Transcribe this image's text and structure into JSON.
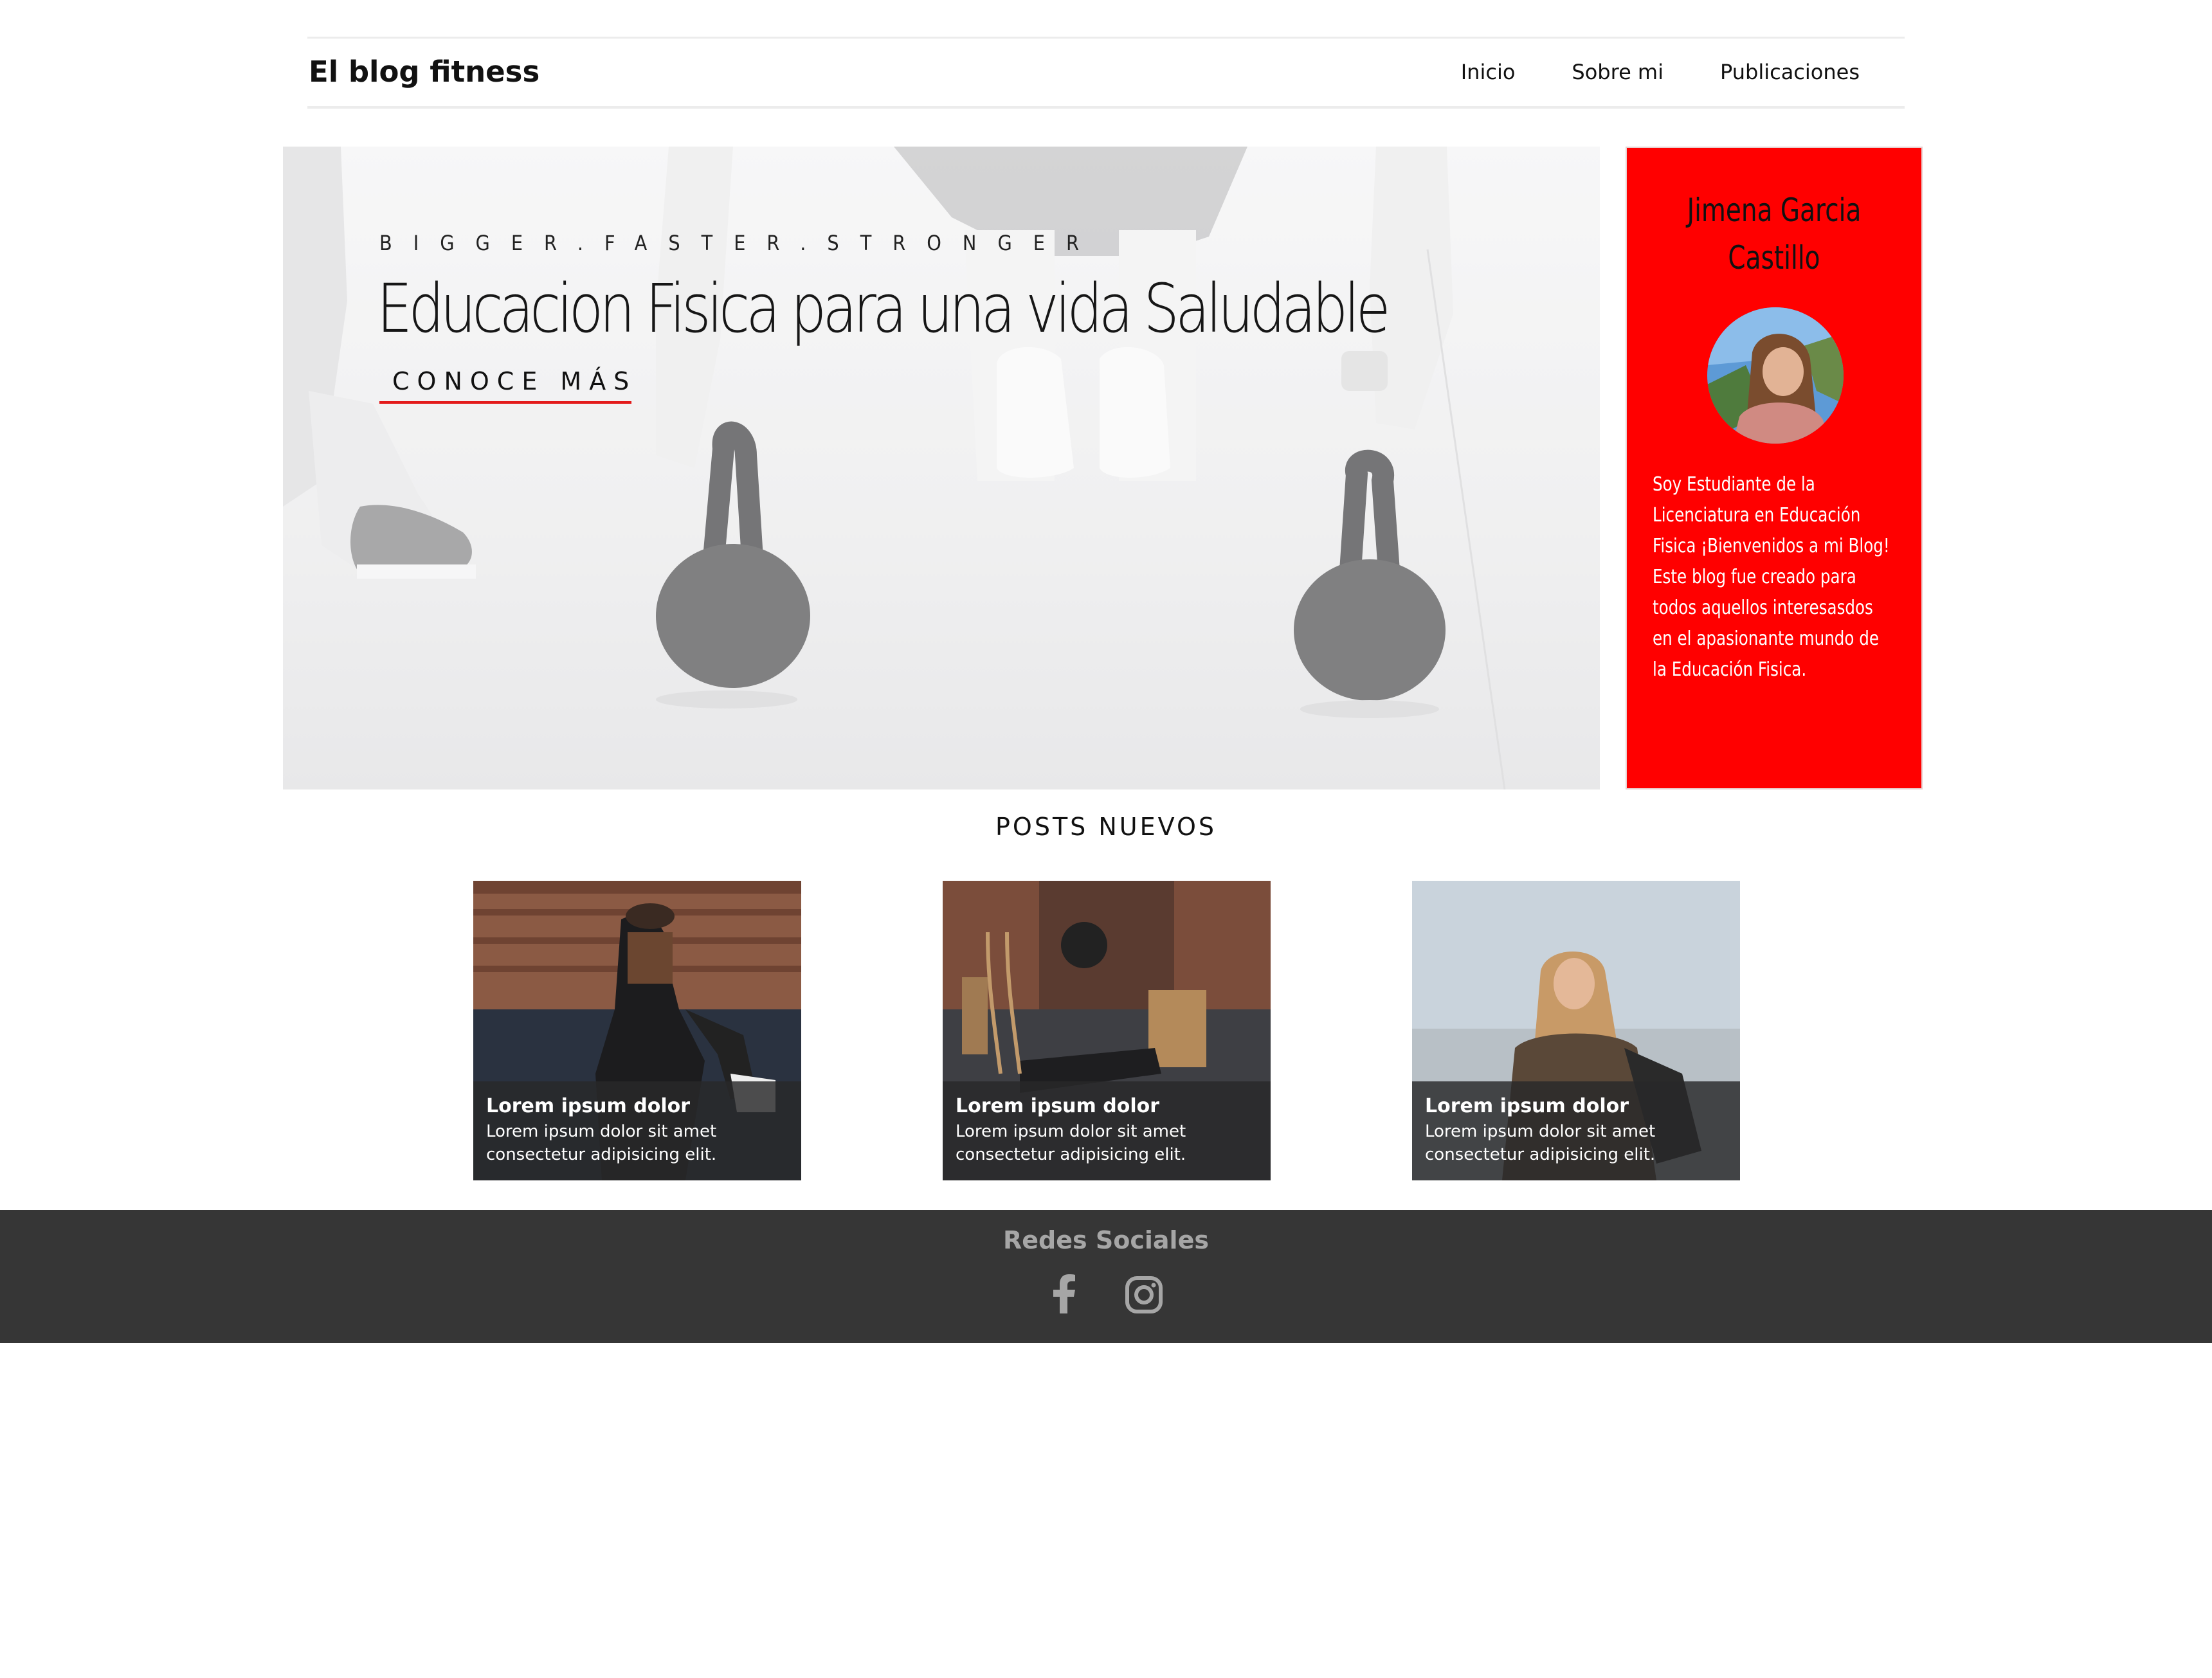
{
  "header": {
    "brand": "El blog fitness",
    "nav": [
      "Inicio",
      "Sobre mi",
      "Publicaciones"
    ]
  },
  "hero": {
    "kicker": "BIGGER.FASTER.STRONGER",
    "title": "Educacion Fisica para una vida Saludable",
    "cta": "CONOCE MÁS"
  },
  "profile": {
    "name_line1": "Jimena Garcia",
    "name_line2": "Castillo",
    "bio": "Soy Estudiante de la Licenciatura en Educación Fisica ¡Bienvenidos a mi Blog! Este blog fue creado para todos aquellos interesasdos en el apasionante mundo de la Educación Fisica."
  },
  "posts": {
    "title": "POSTS NUEVOS",
    "items": [
      {
        "title": "Lorem ipsum dolor",
        "text": "Lorem ipsum dolor sit amet consectetur adipisicing elit."
      },
      {
        "title": "Lorem ipsum dolor",
        "text": "Lorem ipsum dolor sit amet consectetur adipisicing elit."
      },
      {
        "title": "Lorem ipsum dolor",
        "text": "Lorem ipsum dolor sit amet consectetur adipisicing elit."
      }
    ]
  },
  "footer": {
    "title": "Redes Sociales",
    "icons": [
      "facebook-icon",
      "instagram-icon"
    ]
  },
  "colors": {
    "accent_red": "#ff0000",
    "footer_bg": "#363636",
    "cta_underline": "#e31b1b"
  }
}
